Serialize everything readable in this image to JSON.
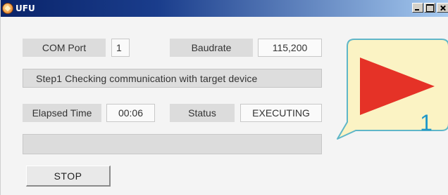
{
  "window": {
    "title": "UFU",
    "controls": [
      "minimize",
      "maximize",
      "close"
    ]
  },
  "com_port": {
    "label": "COM Port",
    "value": "1"
  },
  "baudrate": {
    "label": "Baudrate",
    "value": "115,200"
  },
  "step": {
    "text": "Step1  Checking communication with target device"
  },
  "elapsed_time": {
    "label": "Elapsed Time",
    "value": "00:06"
  },
  "status": {
    "label": "Status",
    "value": "EXECUTING"
  },
  "progress": {
    "fraction": 0
  },
  "stop_button": {
    "label": "STOP"
  },
  "indicator": {
    "number": "1",
    "icon": "play-icon",
    "colors": {
      "panel": "#fbf3c4",
      "border": "#5fb6c8",
      "play": "#e53227",
      "number": "#1f97c9"
    }
  }
}
